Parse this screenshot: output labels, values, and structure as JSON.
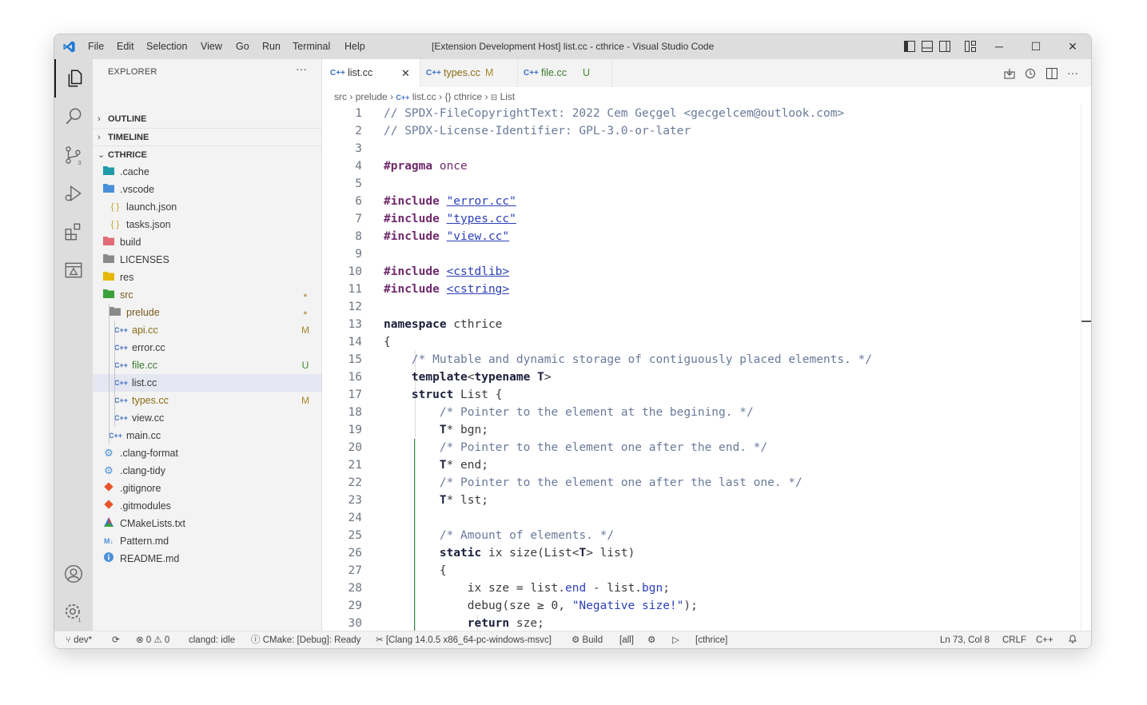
{
  "window": {
    "title": "[Extension Development Host] list.cc - cthrice - Visual Studio Code",
    "menu": [
      "File",
      "Edit",
      "Selection",
      "View",
      "Go",
      "Run",
      "Terminal",
      "Help"
    ],
    "controls": {
      "minimize": "─",
      "maximize": "☐",
      "close": "✕"
    }
  },
  "activity_bar": {
    "items": [
      "explorer-icon",
      "search-icon",
      "source-control-icon",
      "run-debug-icon",
      "extensions-icon",
      "cmake-icon"
    ],
    "source_control_badge": "3",
    "bottom": [
      "account-icon",
      "manage-icon"
    ],
    "manage_badge": "1"
  },
  "sidebar": {
    "title": "EXPLORER",
    "more": "···",
    "sections": {
      "outline": "OUTLINE",
      "timeline": "TIMELINE",
      "workspace": "CTHRICE"
    },
    "tree": [
      {
        "name": ".cache",
        "icon": "folder",
        "color": "#1e9aa8",
        "depth": 0
      },
      {
        "name": ".vscode",
        "icon": "folder-open",
        "color": "#4a8fd9",
        "depth": 0
      },
      {
        "name": "launch.json",
        "icon": "{ }",
        "color": "#c9a227",
        "depth": 1
      },
      {
        "name": "tasks.json",
        "icon": "{ }",
        "color": "#c9a227",
        "depth": 1
      },
      {
        "name": "build",
        "icon": "folder",
        "color": "#e06c75",
        "depth": 0
      },
      {
        "name": "LICENSES",
        "icon": "folder",
        "color": "#8a8a8a",
        "depth": 0
      },
      {
        "name": "res",
        "icon": "folder",
        "color": "#e5b800",
        "depth": 0
      },
      {
        "name": "src",
        "icon": "folder-open",
        "color": "#3aa13a",
        "depth": 0,
        "badge": "●",
        "badge_color": "#c4a87a",
        "name_color": "#7a5a20"
      },
      {
        "name": "prelude",
        "icon": "folder-open",
        "color": "#8a8a8a",
        "depth": 1,
        "badge": "●",
        "badge_color": "#c4a87a",
        "name_color": "#7a5a20"
      },
      {
        "name": "api.cc",
        "icon": "C++",
        "color": "#3b6ec4",
        "depth": 2,
        "badge": "M",
        "badge_color": "#a6882e",
        "name_color": "#8a6a14"
      },
      {
        "name": "error.cc",
        "icon": "C++",
        "color": "#3b6ec4",
        "depth": 2
      },
      {
        "name": "file.cc",
        "icon": "C++",
        "color": "#3b6ec4",
        "depth": 2,
        "badge": "U",
        "badge_color": "#3a8a2a",
        "name_color": "#3a7a2a"
      },
      {
        "name": "list.cc",
        "icon": "C++",
        "color": "#3b6ec4",
        "depth": 2,
        "selected": true
      },
      {
        "name": "types.cc",
        "icon": "C++",
        "color": "#3b6ec4",
        "depth": 2,
        "badge": "M",
        "badge_color": "#a6882e",
        "name_color": "#8a6a14"
      },
      {
        "name": "view.cc",
        "icon": "C++",
        "color": "#3b6ec4",
        "depth": 2
      },
      {
        "name": "main.cc",
        "icon": "C++",
        "color": "#3b6ec4",
        "depth": 1
      },
      {
        "name": ".clang-format",
        "icon": "gear",
        "color": "#4a90d9",
        "depth": 0
      },
      {
        "name": ".clang-tidy",
        "icon": "gear",
        "color": "#4a90d9",
        "depth": 0
      },
      {
        "name": ".gitignore",
        "icon": "git",
        "color": "#e8542b",
        "depth": 0
      },
      {
        "name": ".gitmodules",
        "icon": "git",
        "color": "#e8542b",
        "depth": 0
      },
      {
        "name": "CMakeLists.txt",
        "icon": "cmake",
        "color": "#2e7bcf",
        "depth": 0
      },
      {
        "name": "Pattern.md",
        "icon": "M↓",
        "color": "#4a90d9",
        "depth": 0
      },
      {
        "name": "README.md",
        "icon": "info",
        "color": "#4a90d9",
        "depth": 0
      }
    ]
  },
  "tabs": [
    {
      "label": "list.cc",
      "active": true,
      "close": "✕"
    },
    {
      "label": "types.cc",
      "status": "M",
      "color": "#8a6a14"
    },
    {
      "label": "file.cc",
      "status": "U",
      "color": "#3a7a2a"
    }
  ],
  "tab_actions": [
    "open-changes-icon",
    "timeline-icon",
    "split-editor-icon",
    "more-actions-icon"
  ],
  "breadcrumb": [
    "src",
    "prelude",
    "list.cc",
    "{} cthrice",
    "List"
  ],
  "code": {
    "lines": [
      {
        "n": "1",
        "t": [
          [
            "c-com",
            "// SPDX-FileCopyrightText: 2022 Cem Geçgel <gecgelcem@outlook.com>"
          ]
        ]
      },
      {
        "n": "2",
        "t": [
          [
            "c-com",
            "// SPDX-License-Identifier: GPL-3.0-or-later"
          ]
        ]
      },
      {
        "n": "3",
        "t": []
      },
      {
        "n": "4",
        "t": [
          [
            "c-pp",
            "#pragma"
          ],
          [
            "",
            " "
          ],
          [
            "c-pp2",
            "once"
          ]
        ]
      },
      {
        "n": "5",
        "t": []
      },
      {
        "n": "6",
        "t": [
          [
            "c-pp",
            "#include"
          ],
          [
            "",
            " "
          ],
          [
            "c-str",
            "\"error.cc\""
          ]
        ]
      },
      {
        "n": "7",
        "t": [
          [
            "c-pp",
            "#include"
          ],
          [
            "",
            " "
          ],
          [
            "c-str",
            "\"types.cc\""
          ]
        ]
      },
      {
        "n": "8",
        "t": [
          [
            "c-pp",
            "#include"
          ],
          [
            "",
            " "
          ],
          [
            "c-str",
            "\"view.cc\""
          ]
        ]
      },
      {
        "n": "9",
        "t": []
      },
      {
        "n": "10",
        "t": [
          [
            "c-pp",
            "#include"
          ],
          [
            "",
            " "
          ],
          [
            "c-str",
            "<cstdlib>"
          ]
        ]
      },
      {
        "n": "11",
        "t": [
          [
            "c-pp",
            "#include"
          ],
          [
            "",
            " "
          ],
          [
            "c-str",
            "<cstring>"
          ]
        ]
      },
      {
        "n": "12",
        "t": []
      },
      {
        "n": "13",
        "t": [
          [
            "c-kw",
            "namespace"
          ],
          [
            "",
            " cthrice"
          ]
        ]
      },
      {
        "n": "14",
        "t": [
          [
            "",
            "{"
          ]
        ]
      },
      {
        "n": "15",
        "t": [
          [
            "",
            "    "
          ],
          [
            "c-com",
            "/* Mutable and dynamic storage of contiguously placed elements. */"
          ]
        ]
      },
      {
        "n": "16",
        "t": [
          [
            "",
            "    "
          ],
          [
            "c-kw",
            "template"
          ],
          [
            "",
            "<"
          ],
          [
            "c-kw",
            "typename"
          ],
          [
            "",
            " "
          ],
          [
            "c-ty",
            "T"
          ],
          [
            "",
            ">"
          ]
        ]
      },
      {
        "n": "17",
        "t": [
          [
            "",
            "    "
          ],
          [
            "c-kw",
            "struct"
          ],
          [
            "",
            " List {"
          ]
        ]
      },
      {
        "n": "18",
        "t": [
          [
            "",
            "        "
          ],
          [
            "c-com",
            "/* Pointer to the element at the begining. */"
          ]
        ]
      },
      {
        "n": "19",
        "t": [
          [
            "",
            "        "
          ],
          [
            "c-ty",
            "T"
          ],
          [
            "",
            "* bgn;"
          ]
        ]
      },
      {
        "n": "20",
        "t": [
          [
            "",
            "        "
          ],
          [
            "c-com",
            "/* Pointer to the element one after the end. */"
          ]
        ]
      },
      {
        "n": "21",
        "t": [
          [
            "",
            "        "
          ],
          [
            "c-ty",
            "T"
          ],
          [
            "",
            "* end;"
          ]
        ]
      },
      {
        "n": "22",
        "t": [
          [
            "",
            "        "
          ],
          [
            "c-com",
            "/* Pointer to the element one after the last one. */"
          ]
        ]
      },
      {
        "n": "23",
        "t": [
          [
            "",
            "        "
          ],
          [
            "c-ty",
            "T"
          ],
          [
            "",
            "* lst;"
          ]
        ]
      },
      {
        "n": "24",
        "t": []
      },
      {
        "n": "25",
        "t": [
          [
            "",
            "        "
          ],
          [
            "c-com",
            "/* Amount of elements. */"
          ]
        ]
      },
      {
        "n": "26",
        "t": [
          [
            "",
            "        "
          ],
          [
            "c-kw",
            "static"
          ],
          [
            "",
            " ix size(List<"
          ],
          [
            "c-ty",
            "T"
          ],
          [
            "",
            "> list)"
          ]
        ]
      },
      {
        "n": "27",
        "t": [
          [
            "",
            "        {"
          ]
        ]
      },
      {
        "n": "28",
        "t": [
          [
            "",
            "            ix sze = list."
          ],
          [
            "c-mem",
            "end"
          ],
          [
            "",
            " - list."
          ],
          [
            "c-mem",
            "bgn"
          ],
          [
            "",
            ";"
          ]
        ]
      },
      {
        "n": "29",
        "t": [
          [
            "",
            "            debug(sze ≥ 0, "
          ],
          [
            "c-str2",
            "\"Negative size!\""
          ],
          [
            "",
            ");"
          ]
        ]
      },
      {
        "n": "30",
        "t": [
          [
            "",
            "            "
          ],
          [
            "c-kw",
            "return"
          ],
          [
            "",
            " sze;"
          ]
        ]
      }
    ]
  },
  "status_bar": {
    "branch": "dev*",
    "sync": "⟳",
    "problems": "⊗ 0 ⚠ 0",
    "clangd": "clangd: idle",
    "cmake": "ⓘ CMake: [Debug]: Ready",
    "kit": "[Clang 14.0.5 x86_64-pc-windows-msvc]",
    "build": "Build",
    "target": "[all]",
    "debug": "⚙",
    "run": "▷",
    "launch_target": "[cthrice]",
    "cursor": "Ln 73, Col 8",
    "eol": "CRLF",
    "language": "C++",
    "notifications": "🔔"
  }
}
